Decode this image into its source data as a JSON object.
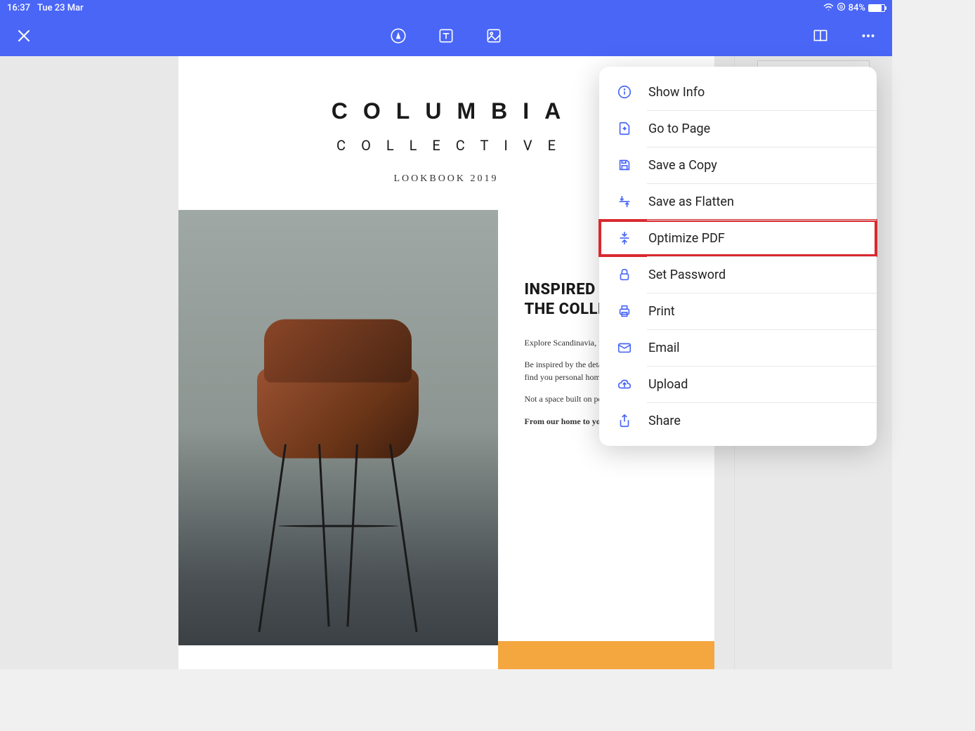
{
  "statusbar": {
    "time": "16:37",
    "date": "Tue 23 Mar",
    "battery_pct": "84%"
  },
  "document": {
    "brand_title": "COLUMBIA",
    "brand_sub": "COLLECTIVE",
    "brand_year": "LOOKBOOK 2019",
    "heading_line1": "INSPIRED B",
    "heading_line2": "THE COLLE",
    "para1": "Explore Scandinavia, meet lo and renowned designers.",
    "para2": "Be inspired by the details of e design and passion to find you personal home expression.",
    "para3": "Not a space built on perfectio home made for living.",
    "para4": "From our home to yours."
  },
  "menu": {
    "items": [
      {
        "id": "show-info",
        "label": "Show Info",
        "icon": "info",
        "highlighted": false
      },
      {
        "id": "go-to-page",
        "label": "Go to Page",
        "icon": "goto",
        "highlighted": false
      },
      {
        "id": "save-copy",
        "label": "Save a Copy",
        "icon": "save",
        "highlighted": false
      },
      {
        "id": "save-flatten",
        "label": "Save as Flatten",
        "icon": "flatten",
        "highlighted": false
      },
      {
        "id": "optimize-pdf",
        "label": "Optimize PDF",
        "icon": "optimize",
        "highlighted": true
      },
      {
        "id": "set-password",
        "label": "Set Password",
        "icon": "lock",
        "highlighted": false
      },
      {
        "id": "print",
        "label": "Print",
        "icon": "print",
        "highlighted": false
      },
      {
        "id": "email",
        "label": "Email",
        "icon": "mail",
        "highlighted": false
      },
      {
        "id": "upload",
        "label": "Upload",
        "icon": "cloud",
        "highlighted": false
      },
      {
        "id": "share",
        "label": "Share",
        "icon": "share",
        "highlighted": false
      }
    ]
  }
}
